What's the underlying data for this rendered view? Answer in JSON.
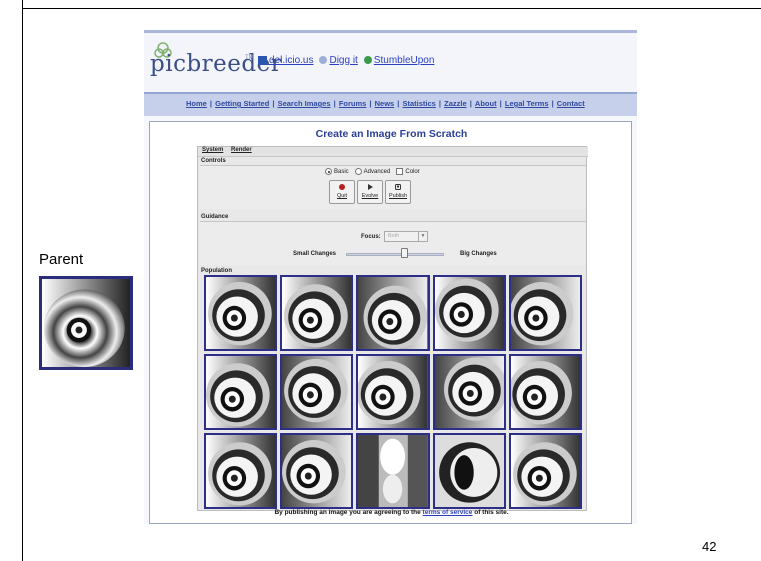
{
  "slide": {
    "page_number": "42",
    "parent_label": "Parent"
  },
  "site": {
    "logo_text": "picbreeder",
    "logo_tm": "TM",
    "social": [
      {
        "label": "del.icio.us",
        "icon": "delicious-icon"
      },
      {
        "label": "Digg it",
        "icon": "digg-icon"
      },
      {
        "label": "StumbleUpon",
        "icon": "stumbleupon-icon"
      }
    ],
    "nav": [
      "Home",
      "Getting Started",
      "Search Images",
      "Forums",
      "News",
      "Statistics",
      "Zazzle",
      "About",
      "Legal Terms",
      "Contact"
    ],
    "nav_separator": "|"
  },
  "page": {
    "title": "Create an Image From Scratch",
    "footer_prefix": "By publishing an image you are agreeing to the",
    "footer_link": "terms of service",
    "footer_suffix": "of this site."
  },
  "app": {
    "menu": [
      "System",
      "Render"
    ],
    "controls_title": "Controls",
    "modes": [
      {
        "label": "Basic",
        "kind": "radio",
        "selected": true
      },
      {
        "label": "Advanced",
        "kind": "radio",
        "selected": false
      },
      {
        "label": "Color",
        "kind": "checkbox",
        "selected": false
      }
    ],
    "buttons": [
      {
        "label": "Quit",
        "icon": "quit-icon",
        "color": "#b22222"
      },
      {
        "label": "Evolve",
        "icon": "play-icon",
        "color": "#333333"
      },
      {
        "label": "Publish",
        "icon": "publish-icon",
        "color": "#333333"
      }
    ],
    "guidance_title": "Guidance",
    "focus_label": "Focus:",
    "focus_value": "Both",
    "small_changes_label": "Small Changes",
    "big_changes_label": "Big Changes",
    "mutation_slider_fraction": 0.6,
    "population_title": "Population",
    "population_count": 15
  },
  "colors": {
    "frame_blue": "#2b2f86",
    "link_blue": "#2a3fc0",
    "nav_bg": "#c6d0ea"
  }
}
